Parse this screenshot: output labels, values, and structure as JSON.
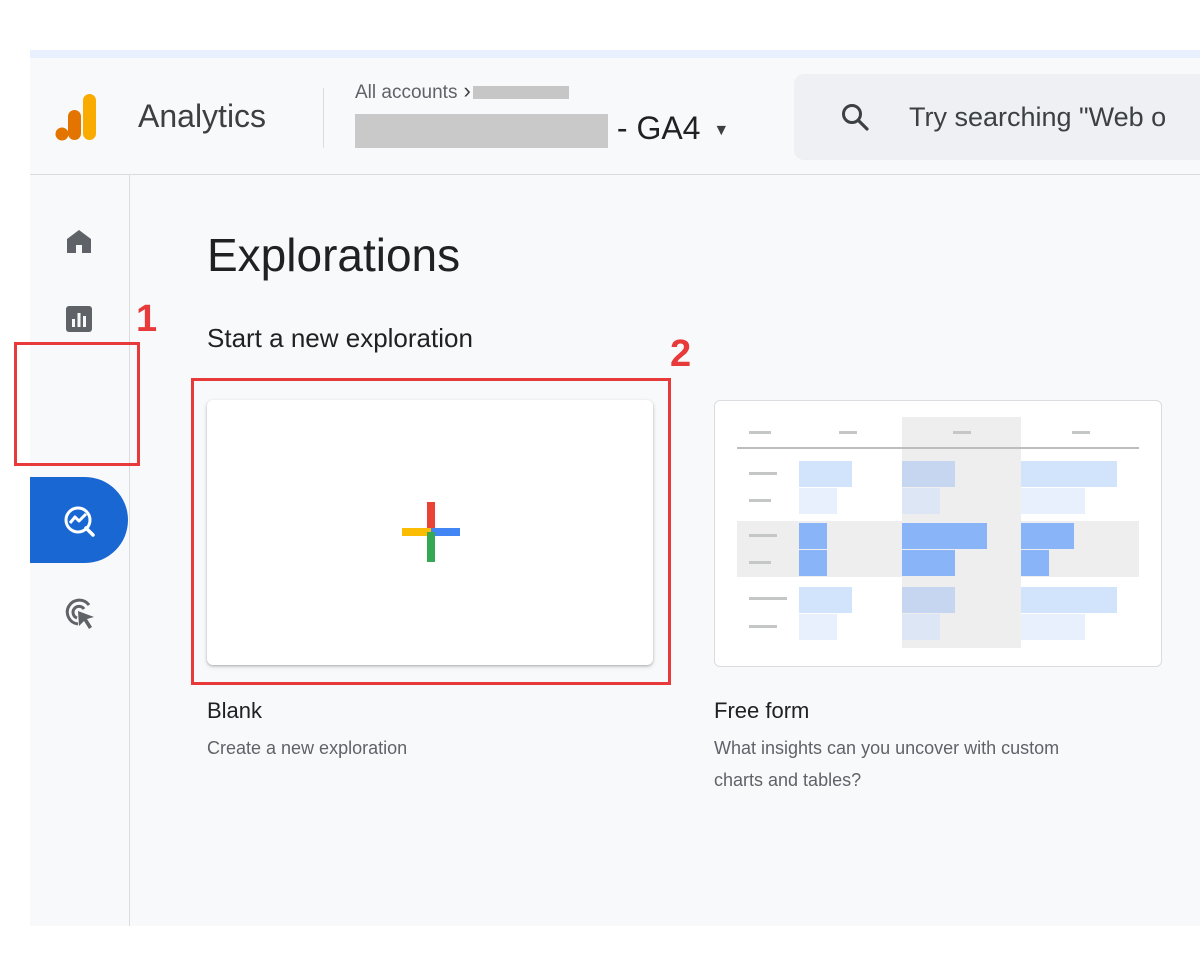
{
  "header": {
    "app_name": "Analytics",
    "breadcrumb_root": "All accounts",
    "property_suffix": "- GA4",
    "search_placeholder": "Try searching \"Web o"
  },
  "page": {
    "title": "Explorations",
    "section": "Start a new exploration"
  },
  "templates": [
    {
      "label": "Blank",
      "description": "Create a new exploration"
    },
    {
      "label": "Free form",
      "description_line1": "What insights can you uncover with custom",
      "description_line2": "charts and tables?"
    }
  ],
  "annotations": {
    "n1": "1",
    "n2": "2"
  },
  "colors": {
    "accent": "#1967d2",
    "annotation": "#e83a3a",
    "logo_orange": "#f9ab00",
    "logo_dark_orange": "#e37400",
    "google_blue": "#4285f4",
    "google_red": "#ea4335",
    "google_yellow": "#fbbc04",
    "google_green": "#34a853"
  },
  "icons": {
    "nav": [
      "home-icon",
      "reports-icon",
      "explore-icon",
      "advertising-icon"
    ],
    "search": "search-icon",
    "dropdown": "caret-down-icon",
    "breadcrumb": "chevron-right-icon"
  }
}
